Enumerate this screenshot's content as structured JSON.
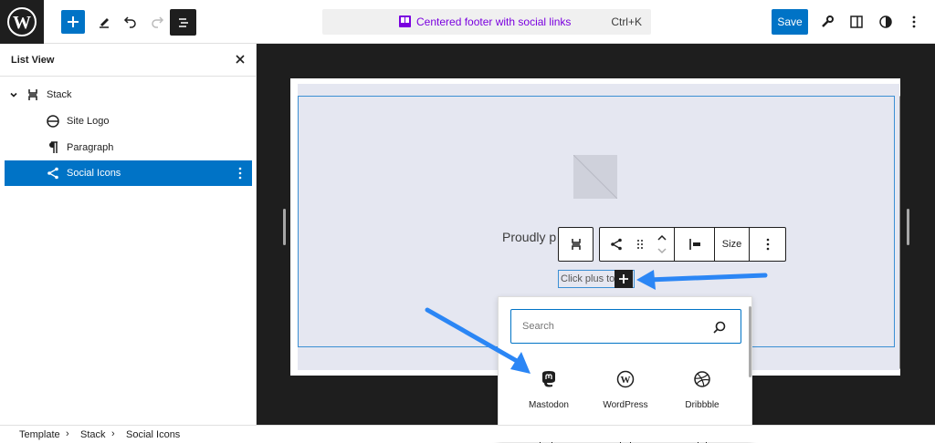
{
  "header": {
    "command_bar_title": "Centered footer with social links",
    "command_bar_shortcut": "Ctrl+K",
    "save_label": "Save"
  },
  "list_view": {
    "title": "List View",
    "items": [
      {
        "label": "Stack",
        "icon": "stack-icon"
      },
      {
        "label": "Site Logo",
        "icon": "site-logo-icon"
      },
      {
        "label": "Paragraph",
        "icon": "paragraph-icon"
      },
      {
        "label": "Social Icons",
        "icon": "share-icon"
      }
    ]
  },
  "canvas": {
    "paragraph_text": "Proudly p",
    "placeholder_text": "Click plus to a"
  },
  "block_toolbar": {
    "size_label": "Size"
  },
  "inserter": {
    "search_placeholder": "Search",
    "blocks": [
      {
        "label": "Mastodon",
        "icon": "mastodon-icon"
      },
      {
        "label": "WordPress",
        "icon": "wordpress-icon"
      },
      {
        "label": "Dribbble",
        "icon": "dribbble-icon"
      }
    ]
  },
  "breadcrumb": [
    "Template",
    "Stack",
    "Social Icons"
  ],
  "colors": {
    "accent": "#0073c6",
    "dark": "#1e1e1e",
    "pattern_purple": "#7a00df",
    "annotation_arrow": "#2b86f5"
  }
}
